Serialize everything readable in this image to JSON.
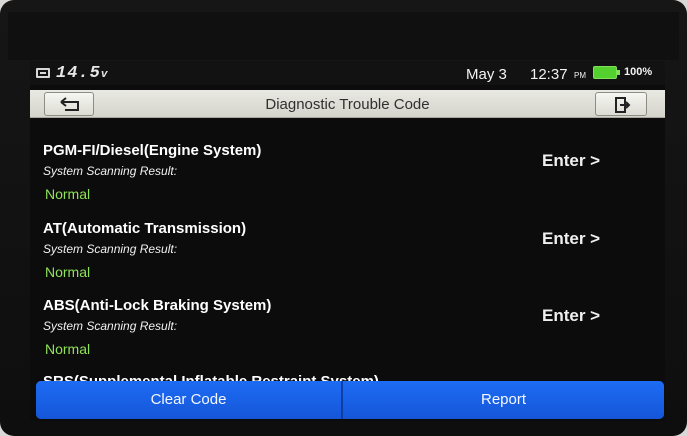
{
  "status_bar": {
    "voltage": "14.5",
    "voltage_unit": "v",
    "date": "May 3",
    "time": "12:37",
    "ampm": "PM",
    "battery_percent": "100%",
    "battery_level": 1.0,
    "battery_color": "#55d12f"
  },
  "header": {
    "title": "Diagnostic Trouble Code",
    "back_icon": "back-arrow-icon",
    "exit_icon": "exit-door-icon"
  },
  "systems": [
    {
      "name": "PGM-FI/Diesel(Engine System)",
      "scan_label": "System Scanning Result:",
      "result": "Normal",
      "enter_label": "Enter >"
    },
    {
      "name": "AT(Automatic Transmission)",
      "scan_label": "System Scanning Result:",
      "result": "Normal",
      "enter_label": "Enter >"
    },
    {
      "name": "ABS(Anti-Lock Braking System)",
      "scan_label": "System Scanning Result:",
      "result": "Normal",
      "enter_label": "Enter >"
    }
  ],
  "partial_system": {
    "name": "SRS(Supplemental Inflatable Restraint System)"
  },
  "footer": {
    "clear_code_label": "Clear Code",
    "report_label": "Report",
    "accent_color": "#1d6cf4"
  }
}
